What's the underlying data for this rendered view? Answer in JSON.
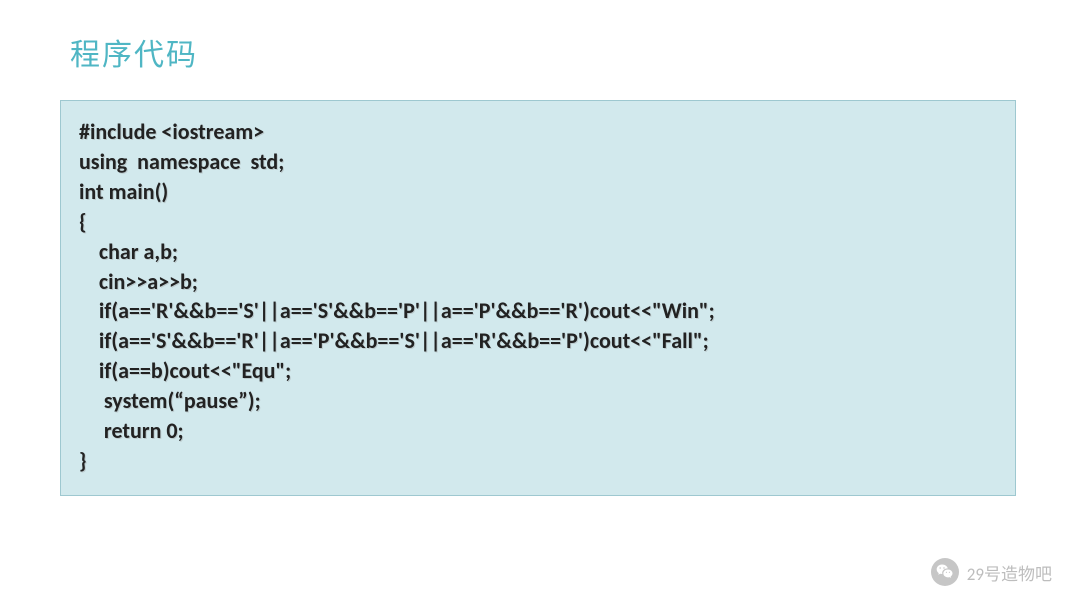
{
  "title": "程序代码",
  "code": "#include <iostream>\nusing  namespace  std;\nint main()\n{\n    char a,b;\n    cin>>a>>b;\n    if(a=='R'&&b=='S'||a=='S'&&b=='P'||a=='P'&&b=='R')cout<<\"Win\";\n    if(a=='S'&&b=='R'||a=='P'&&b=='S'||a=='R'&&b=='P')cout<<\"Fall\";\n    if(a==b)cout<<\"Equ\";\n     system(“pause”);\n     return 0;\n}",
  "watermark": "29号造物吧"
}
